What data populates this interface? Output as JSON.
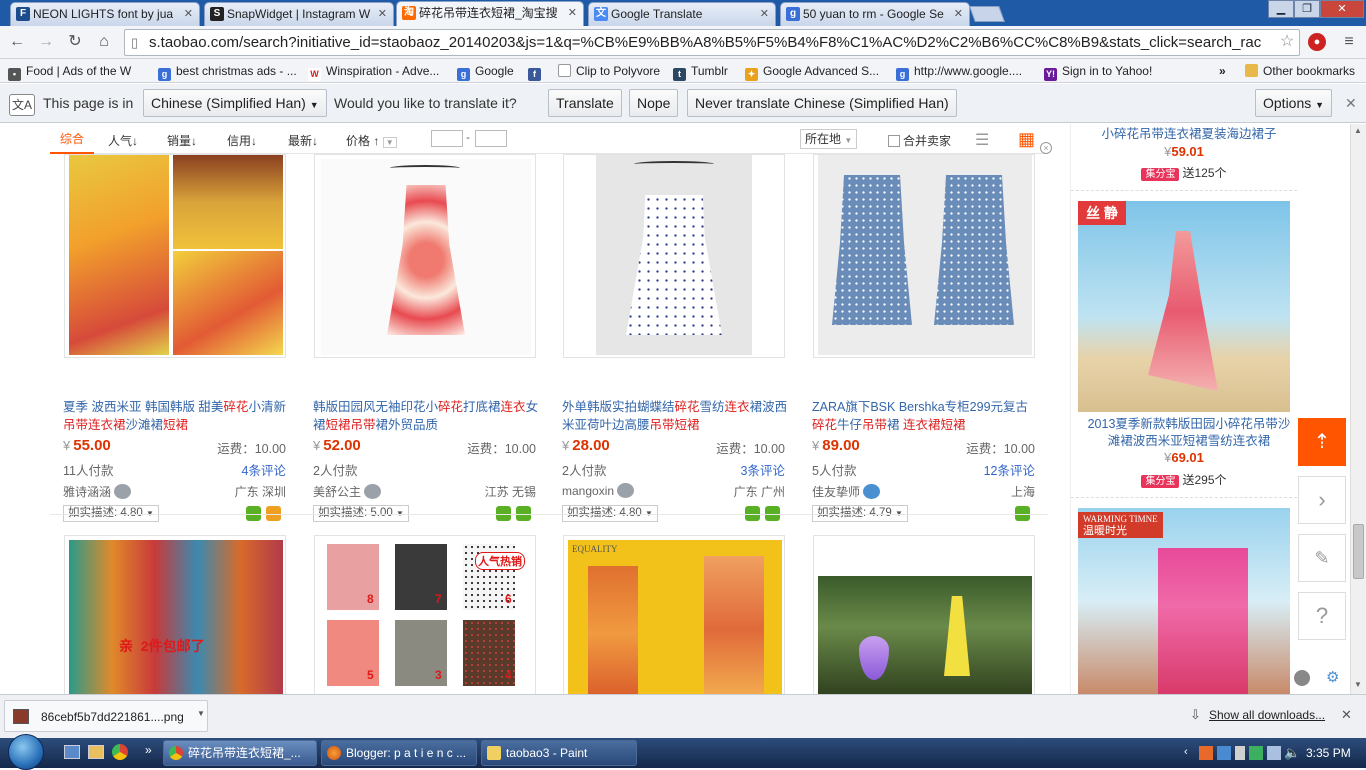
{
  "browser": {
    "tabs": [
      {
        "label": "NEON LIGHTS font by jua",
        "icon": "fontspace-favicon-icon"
      },
      {
        "label": "SnapWidget | Instagram W",
        "icon": "snapwidget-favicon-icon"
      },
      {
        "label": "碎花吊带连衣短裙_淘宝搜",
        "icon": "taobao-favicon-icon"
      },
      {
        "label": "Google Translate",
        "icon": "google-translate-favicon-icon"
      },
      {
        "label": "50 yuan to rm - Google Se",
        "icon": "google-favicon-icon"
      }
    ],
    "url": "s.taobao.com/search?initiative_id=staobaoz_20140203&js=1&q=%CB%E9%BB%A8%B5%F5%B4%F8%C1%AC%D2%C2%B6%CC%C8%B9&stats_click=search_rac",
    "bookmarks": [
      "Food | Ads of the W",
      "best christmas ads - ...",
      "Winspiration - Adve...",
      "Google",
      "",
      "Clip to Polyvore",
      "Tumblr",
      "Google Advanced S...",
      "http://www.google....",
      "Sign in to Yahoo!"
    ],
    "bookmarks_more": "»",
    "other_bookmarks": "Other bookmarks"
  },
  "translate": {
    "this_page_is_in": "This page is in",
    "language": "Chinese (Simplified Han)",
    "question": "Would you like to translate it?",
    "translate_btn": "Translate",
    "nope_btn": "Nope",
    "never_btn": "Never translate Chinese (Simplified Han)",
    "options_btn": "Options"
  },
  "filters": {
    "sort_all": "综合",
    "popularity": "人气",
    "sales": "销量",
    "credit": "信用",
    "newest": "最新",
    "price": "价格",
    "price_sep": "-",
    "location": "所在地",
    "merge_sellers": "合并卖家"
  },
  "products": [
    {
      "title_parts": [
        [
          "夏季 波西米亚 韩国韩版 甜美",
          false
        ],
        [
          "碎花",
          true
        ],
        [
          "小清新",
          false
        ],
        [
          "吊带连衣裙",
          true
        ],
        [
          "沙滩裙",
          false
        ],
        [
          "短裙",
          true
        ]
      ],
      "price": "55.00",
      "shipping": "运费：10.00",
      "buyers": "11人付款",
      "reviews": "4条评论",
      "seller": "雅诗涵涵",
      "location": "广东 深圳",
      "desc": "如实描述: 4.80"
    },
    {
      "title_parts": [
        [
          "韩版田园风无袖印花小",
          false
        ],
        [
          "碎花",
          true
        ],
        [
          "打底裙",
          false
        ],
        [
          "连衣",
          true
        ],
        [
          "女裙",
          false
        ],
        [
          "短裙吊带",
          true
        ],
        [
          "裙外贸品质",
          false
        ]
      ],
      "price": "52.00",
      "shipping": "运费：10.00",
      "buyers": "2人付款",
      "reviews": "",
      "seller": "美舒公主",
      "location": "江苏 无锡",
      "desc": "如实描述: 5.00"
    },
    {
      "title_parts": [
        [
          "外单韩版实拍蝴蝶结",
          false
        ],
        [
          "碎花",
          true
        ],
        [
          "雪纺",
          false
        ],
        [
          "连衣",
          true
        ],
        [
          "裙波西米亚荷叶边高腰",
          false
        ],
        [
          "吊带短裙",
          true
        ]
      ],
      "price": "28.00",
      "shipping": "运费：10.00",
      "buyers": "2人付款",
      "reviews": "3条评论",
      "seller": "mangoxin",
      "location": "广东 广州",
      "desc": "如实描述: 4.80"
    },
    {
      "title_parts": [
        [
          "ZARA旗下BSK Bershka专柜299元复古",
          false
        ],
        [
          "碎花",
          true
        ],
        [
          "牛仔",
          false
        ],
        [
          "吊带",
          true
        ],
        [
          "裙 ",
          false
        ],
        [
          "连衣裙短裙",
          true
        ]
      ],
      "price": "89.00",
      "shipping": "运费：10.00",
      "buyers": "5人付款",
      "reviews": "12条评论",
      "seller": "佳友挚师",
      "location": "上海",
      "desc": "如实描述: 4.79"
    }
  ],
  "second_row_overlays": {
    "card1_text": "亲  2件包邮了",
    "card2_badge": "人气热销",
    "card2_numbers": [
      "8",
      "7",
      "6",
      "5",
      "3",
      "4"
    ],
    "card3_brand": "EQUALITY"
  },
  "right_column": [
    {
      "title": "小碎花吊带连衣裙夏装海边裙子",
      "price": "59.01",
      "jifen": "集分宝",
      "jifen_text": "送125个"
    },
    {
      "banner": "丝 静",
      "title": "2013夏季新款韩版田园小碎花吊带沙滩裙波西米亚短裙雪纺连衣裙",
      "price": "69.01",
      "jifen": "集分宝",
      "jifen_text": "送295个"
    },
    {
      "banner_top": "WARMING TIMNE",
      "banner_bottom": "温暖时光"
    }
  ],
  "downloads": {
    "file": "86cebf5b7dd221861....png",
    "show_all": "Show all downloads..."
  },
  "taskbar": {
    "tasks": [
      "碎花吊带连衣短裙_...",
      "Blogger: p a t i e n c ...",
      "taobao3 - Paint"
    ],
    "time": "3:35 PM"
  },
  "colors": {
    "accent": "#ff5500",
    "link": "#3366aa",
    "price": "#dd3300",
    "taskbar": "#1c3a66"
  }
}
